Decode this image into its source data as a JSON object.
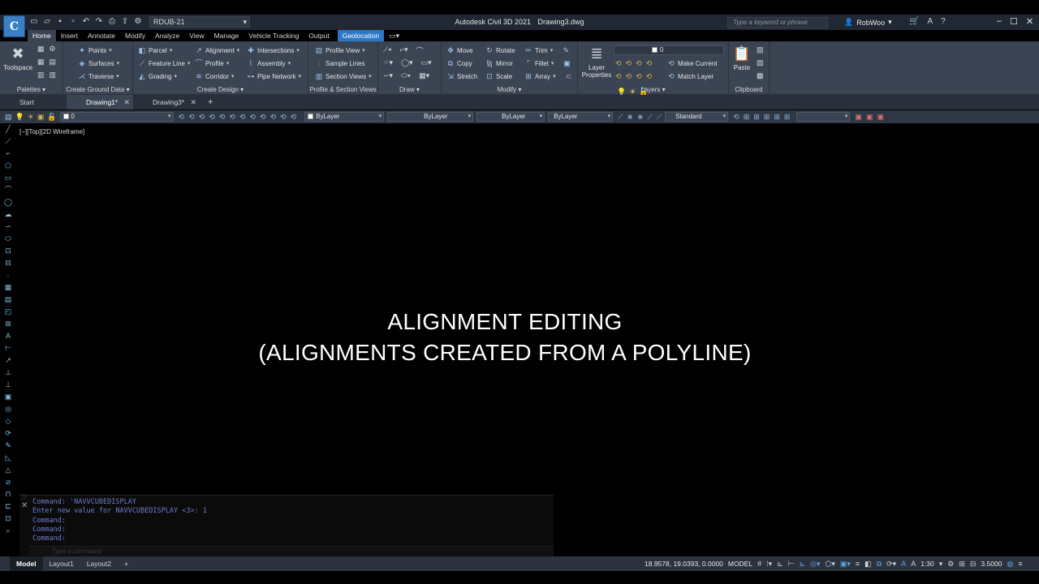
{
  "titlebar": {
    "logo_letter": "C",
    "workspace": "RDUB-21",
    "app_name": "Autodesk Civil 3D 2021",
    "document": "Drawing3.dwg",
    "search_placeholder": "Type a keyword or phrase",
    "user": "RobWoo"
  },
  "ribbon_tabs": [
    "Home",
    "Insert",
    "Annotate",
    "Modify",
    "Analyze",
    "View",
    "Manage",
    "Vehicle Tracking",
    "Output",
    "Geolocation"
  ],
  "ribbon": {
    "palettes": {
      "title": "Palettes",
      "toolspace": "Toolspace"
    },
    "ground": {
      "title": "Create Ground Data",
      "points": "Points",
      "surfaces": "Surfaces",
      "traverse": "Traverse"
    },
    "design": {
      "title": "Create Design",
      "parcel": "Parcel",
      "feature_line": "Feature Line",
      "grading": "Grading",
      "alignment": "Alignment",
      "profile": "Profile",
      "corridor": "Corridor",
      "intersections": "Intersections",
      "assembly": "Assembly",
      "pipe_network": "Pipe Network"
    },
    "profile_section": {
      "title": "Profile & Section Views",
      "profile_view": "Profile View",
      "sample_lines": "Sample Lines",
      "section_views": "Section Views"
    },
    "draw": {
      "title": "Draw"
    },
    "modify": {
      "title": "Modify",
      "move": "Move",
      "copy": "Copy",
      "stretch": "Stretch",
      "rotate": "Rotate",
      "mirror": "Mirror",
      "scale": "Scale",
      "trim": "Trim",
      "fillet": "Fillet",
      "array": "Array"
    },
    "layers": {
      "title": "Layers",
      "layer_properties_1": "Layer",
      "layer_properties_2": "Properties",
      "current_layer": "0",
      "make_current": "Make Current",
      "match_layer": "Match Layer"
    },
    "clipboard": {
      "title": "Clipboard",
      "paste": "Paste"
    }
  },
  "file_tabs": [
    {
      "label": "Start"
    },
    {
      "label": "Drawing1*"
    },
    {
      "label": "Drawing3*"
    }
  ],
  "properties_bar": {
    "layer": "0",
    "color": "ByLayer",
    "linetype": "ByLayer",
    "lineweight": "ByLayer",
    "plotstyle": "ByLayer",
    "textstyle": "Standard"
  },
  "viewport": {
    "label": "[−][Top][2D Wireframe]"
  },
  "headline": {
    "line1": "ALIGNMENT EDITING",
    "line2": "(ALIGNMENTS CREATED FROM A POLYLINE)"
  },
  "command": {
    "history": [
      "Command: 'NAVVCUBEDISPLAY",
      "Enter new value for NAVVCUBEDISPLAY <3>: 1",
      "Command:",
      "Command:",
      "Command:"
    ],
    "placeholder": "Type a command"
  },
  "status": {
    "layouts": [
      "Model",
      "Layout1",
      "Layout2"
    ],
    "coordinates": "18.9578, 19.0393, 0.0000",
    "space": "MODEL",
    "scale": "1:30",
    "elevation": "3.5000"
  }
}
